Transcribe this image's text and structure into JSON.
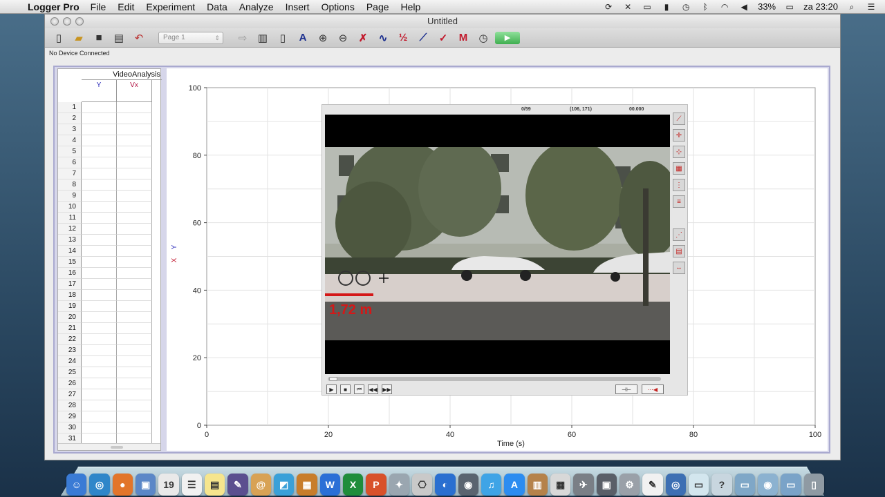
{
  "menubar": {
    "app_name": "Logger Pro",
    "items": [
      "File",
      "Edit",
      "Experiment",
      "Data",
      "Analyze",
      "Insert",
      "Options",
      "Page",
      "Help"
    ],
    "battery": "33%",
    "clock": "za 23:20"
  },
  "window": {
    "title": "Untitled",
    "page_select": "Page 1",
    "status": "No Device Connected"
  },
  "table": {
    "group_title": "VideoAnalysis",
    "columns": [
      "Y",
      "Vx"
    ],
    "row_count": 31
  },
  "graph": {
    "y_axis_labels": [
      "Y",
      "X"
    ],
    "y_axis_label_colors": [
      "#2a2ab8",
      "#c0142c"
    ],
    "x_axis_label": "Time (s)",
    "x_ticks": [
      "0",
      "20",
      "40",
      "60",
      "80",
      "100"
    ],
    "y_ticks": [
      "0",
      "20",
      "40",
      "60",
      "80",
      "100"
    ],
    "xlim": [
      0,
      100
    ],
    "ylim": [
      0,
      100
    ],
    "grid": true
  },
  "movie": {
    "frame_counter": "0/59",
    "coordinates": "(106, 171)",
    "time_readout": "00.000",
    "scale_label": "1,72 m"
  },
  "icons": {
    "dock": [
      "finder-icon",
      "safari-icon",
      "firefox-icon",
      "preview-icon",
      "calendar-icon",
      "reminders-icon",
      "stickies-icon",
      "pen-icon",
      "contacts-icon",
      "photo-icon",
      "keynote-icon",
      "word-icon",
      "excel-icon",
      "powerpoint-icon",
      "tool-icon",
      "preview2-icon",
      "globe-icon",
      "camera-icon",
      "itunes-icon",
      "appstore-icon",
      "photos-icon",
      "calculator-icon",
      "launchpad-icon",
      "system-icon",
      "settings-icon",
      "textedit-icon",
      "quicktime-icon",
      "document-icon",
      "help-icon",
      "folder-icon",
      "downloads-icon",
      "applications-icon",
      "trash-icon"
    ]
  }
}
